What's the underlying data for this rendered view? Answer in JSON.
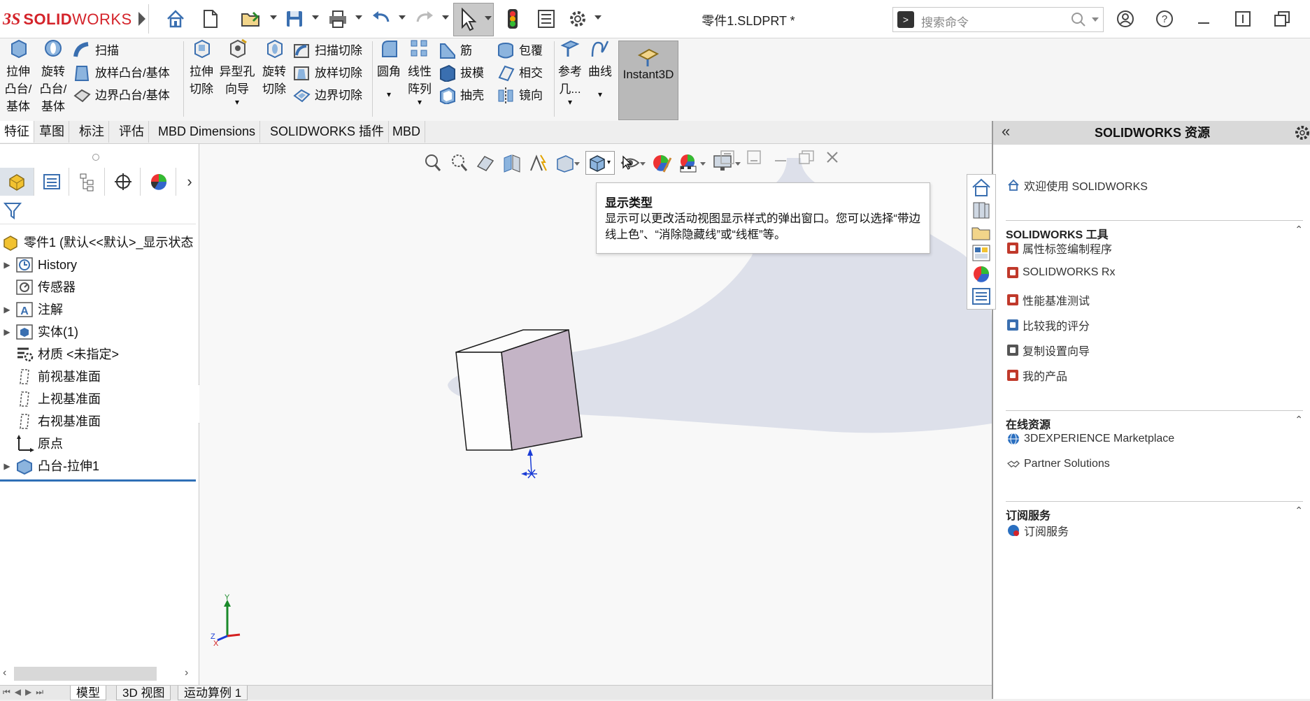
{
  "titlebar": {
    "logo_prefix": "3S",
    "logo_text_bold": "SOLID",
    "logo_text_light": "WORKS",
    "document_title": "零件1.SLDPRT *",
    "search_placeholder": "搜索命令"
  },
  "command_manager": {
    "extrude_boss": "拉伸\n凸台/\n基体",
    "revolve_boss": "旋转\n凸台/\n基体",
    "sweep": "扫描",
    "loft_boss": "放样凸台/基体",
    "boundary_boss": "边界凸台/基体",
    "extrude_cut": "拉伸\n切除",
    "hole_wizard": "异型孔\n向导",
    "revolve_cut": "旋转\n切除",
    "sweep_cut": "扫描切除",
    "loft_cut": "放样切除",
    "boundary_cut": "边界切除",
    "fillet": "圆角",
    "linear_pattern": "线性\n阵列",
    "rib": "筋",
    "draft": "拔模",
    "shell": "抽壳",
    "wrap": "包覆",
    "intersect": "相交",
    "mirror": "镜向",
    "reference_geometry": "参考\n几...",
    "curves": "曲线",
    "instant3d": "Instant3D"
  },
  "tabs": [
    "特征",
    "草图",
    "标注",
    "评估",
    "MBD Dimensions",
    "SOLIDWORKS 插件",
    "MBD"
  ],
  "feature_tree": {
    "root": "零件1  (默认<<默认>_显示状态",
    "items": [
      {
        "label": "History",
        "expandable": true
      },
      {
        "label": "传感器",
        "expandable": false
      },
      {
        "label": "注解",
        "expandable": true
      },
      {
        "label": "实体(1)",
        "expandable": true
      },
      {
        "label": "材质 <未指定>",
        "expandable": false
      },
      {
        "label": "前视基准面",
        "expandable": false
      },
      {
        "label": "上视基准面",
        "expandable": false
      },
      {
        "label": "右视基准面",
        "expandable": false
      },
      {
        "label": "原点",
        "expandable": false
      },
      {
        "label": "凸台-拉伸1",
        "expandable": true
      }
    ]
  },
  "tooltip": {
    "title": "显示类型",
    "body": "显示可以更改活动视图显示样式的弹出窗口。您可以选择“带边线上色”、“消除隐藏线”或“线框”等。"
  },
  "triad": {
    "x": "X",
    "y": "Y",
    "z": "Z"
  },
  "resources_panel": {
    "title": "SOLIDWORKS 资源",
    "welcome": "欢迎使用  SOLIDWORKS",
    "tools_header": "SOLIDWORKS 工具",
    "tools": [
      "属性标签编制程序",
      "SOLIDWORKS Rx",
      "性能基准测试",
      "比较我的评分",
      "复制设置向导",
      "我的产品"
    ],
    "online_header": "在线资源",
    "online": [
      "3DEXPERIENCE Marketplace",
      "Partner Solutions"
    ],
    "subscription_header": "订阅服务",
    "subscription": [
      "订阅服务"
    ]
  },
  "bottom_tabs": [
    "模型",
    "3D 视图",
    "运动算例 1"
  ],
  "colors": {
    "brand_red": "#d4232a",
    "cube_side": "#c4b4c6",
    "background_shape": "#dde0ea"
  }
}
